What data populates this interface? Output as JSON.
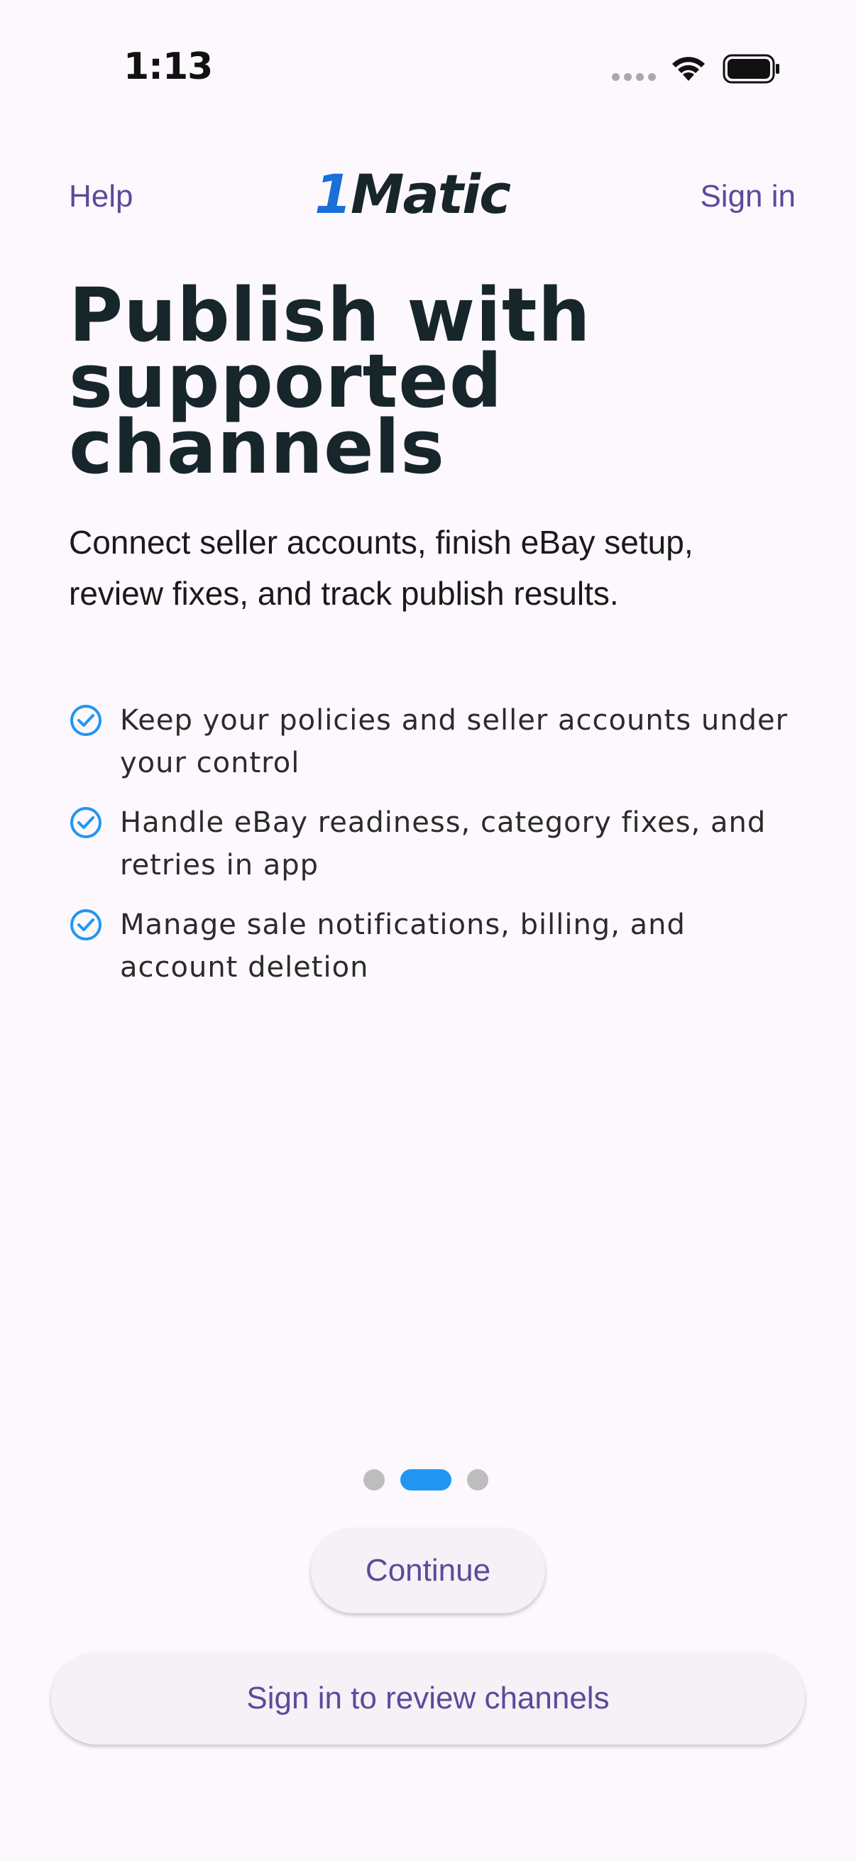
{
  "status_bar": {
    "time": "1:13",
    "icons": [
      "signal-dots-icon",
      "wifi-icon",
      "battery-icon"
    ]
  },
  "nav": {
    "help_label": "Help",
    "logo_text": "1Matic",
    "signin_label": "Sign in"
  },
  "hero": {
    "title": "Publish with supported channels",
    "subtitle": "Connect seller accounts, finish eBay setup, review fixes, and track publish results."
  },
  "features": [
    {
      "icon": "check-circle-icon",
      "text": "Keep your policies and seller accounts under your control"
    },
    {
      "icon": "check-circle-icon",
      "text": "Handle eBay readiness, category fixes, and retries in app"
    },
    {
      "icon": "check-circle-icon",
      "text": "Manage sale notifications, billing, and account deletion"
    }
  ],
  "pager": {
    "total": 3,
    "active_index": 1
  },
  "actions": {
    "continue_label": "Continue",
    "signin_review_label": "Sign in to review channels"
  },
  "colors": {
    "background": "#fdf8fd",
    "title": "#17262b",
    "link": "#5b4a9a",
    "accent": "#2196f3",
    "logo_blue": "#1a6fd8",
    "logo_dark": "#17262b"
  }
}
